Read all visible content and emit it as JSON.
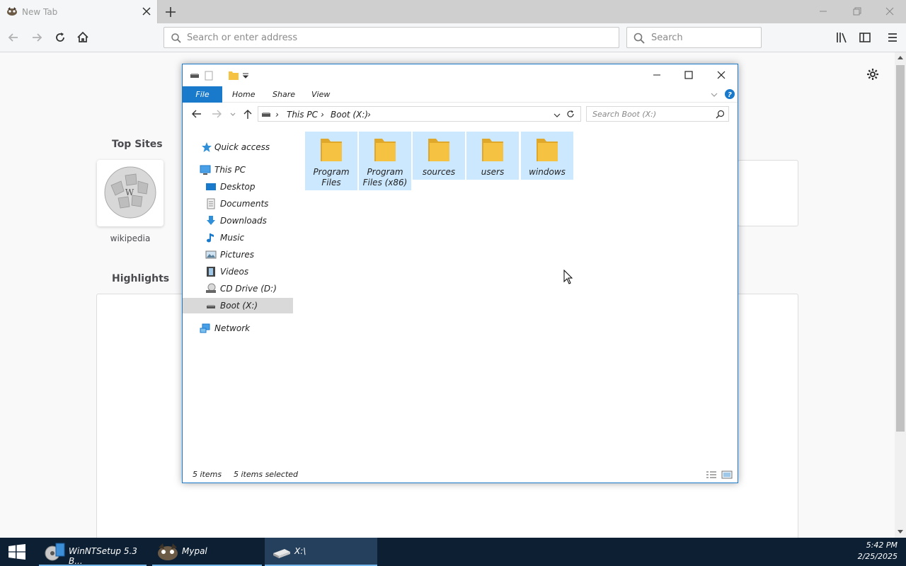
{
  "browser": {
    "tab_title": "New Tab",
    "url_placeholder": "Search or enter address",
    "search_placeholder": "Search"
  },
  "newtab": {
    "top_sites_title": "Top Sites",
    "highlights_title": "Highlights",
    "top_sites": [
      {
        "label": "wikipedia"
      }
    ]
  },
  "explorer": {
    "ribbon_tabs": [
      "File",
      "Home",
      "Share",
      "View"
    ],
    "breadcrumb": [
      "This PC",
      "Boot (X:)"
    ],
    "search_placeholder": "Search Boot (X:)",
    "nav": {
      "quick_access": "Quick access",
      "this_pc": "This PC",
      "desktop": "Desktop",
      "documents": "Documents",
      "downloads": "Downloads",
      "music": "Music",
      "pictures": "Pictures",
      "videos": "Videos",
      "cd_drive": "CD Drive (D:)",
      "boot": "Boot (X:)",
      "network": "Network"
    },
    "items": [
      {
        "name": "Program Files",
        "line1": "Program",
        "line2": "Files",
        "selected": true
      },
      {
        "name": "Program Files (x86)",
        "line1": "Program",
        "line2": "Files (x86)",
        "selected": true
      },
      {
        "name": "sources",
        "line1": "sources",
        "line2": "",
        "selected": true
      },
      {
        "name": "users",
        "line1": "users",
        "line2": "",
        "selected": true
      },
      {
        "name": "windows",
        "line1": "windows",
        "line2": "",
        "selected": true
      }
    ],
    "status_count": "5 items",
    "status_selected": "5 items selected"
  },
  "taskbar": {
    "items": [
      "WinNTSetup 5.3 B...",
      "Mypal",
      "X:\\"
    ],
    "time": "5:42 PM",
    "date": "2/25/2025"
  },
  "colors": {
    "accent": "#1979ca",
    "selection": "#cce8ff",
    "taskbar": "#0c1f33",
    "folder": "#f5c242"
  }
}
